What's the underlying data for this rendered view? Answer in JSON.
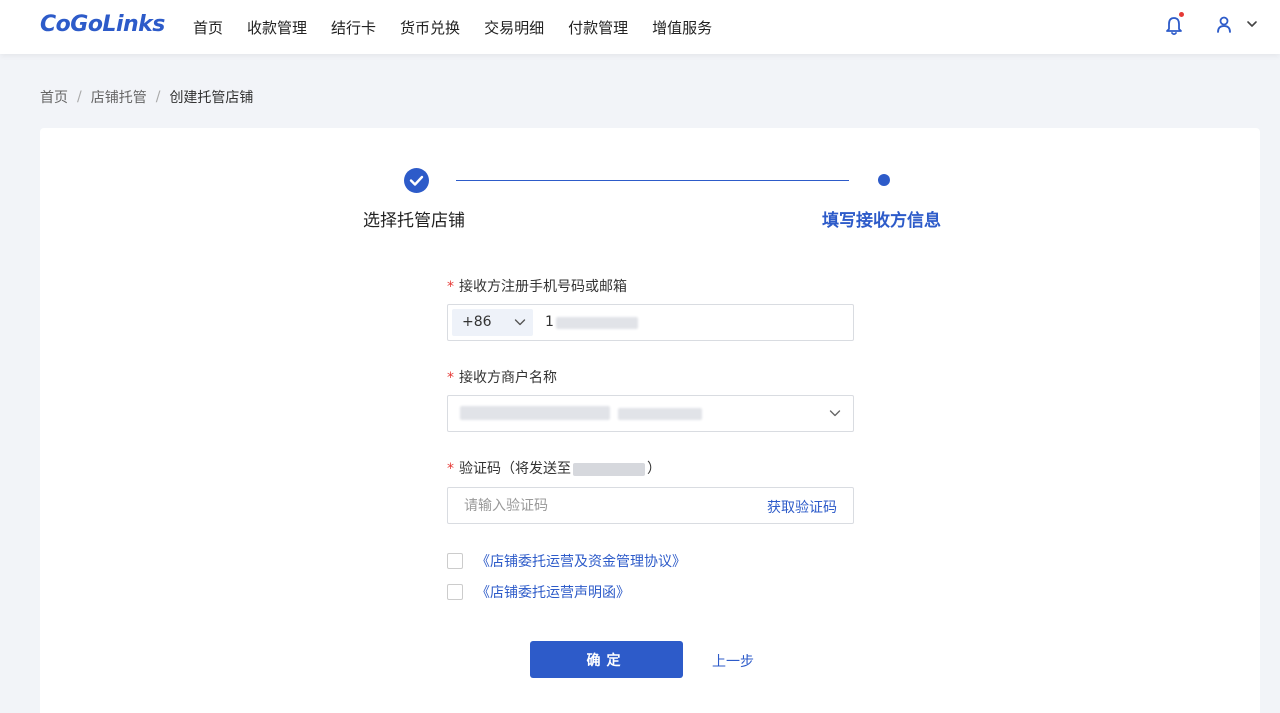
{
  "app": {
    "logo_text": "CoGoLinks",
    "brand_color": "#2d5bc9"
  },
  "nav": [
    {
      "label": "首页"
    },
    {
      "label": "收款管理"
    },
    {
      "label": "结行卡"
    },
    {
      "label": "货币兑换"
    },
    {
      "label": "交易明细"
    },
    {
      "label": "付款管理"
    },
    {
      "label": "增值服务"
    }
  ],
  "header_icons": {
    "bell": "bell-icon",
    "user": "user-icon",
    "menu": "chevron-down-icon"
  },
  "breadcrumb": {
    "home": "首页",
    "parent": "店铺托管",
    "current": "创建托管店铺"
  },
  "steps": {
    "step1": "选择托管店铺",
    "step2": "填写接收方信息"
  },
  "form": {
    "phone": {
      "label": "接收方注册手机号码或邮箱",
      "country_code": "+86",
      "value_visible": "1"
    },
    "merchant": {
      "label": "接收方商户名称"
    },
    "verify": {
      "label": "验证码（将发送至",
      "label_end": "）",
      "placeholder": "请输入验证码",
      "get_code": "获取验证码"
    }
  },
  "agreements": [
    {
      "text": "《店铺委托运营及资金管理协议》"
    },
    {
      "text": "《店铺委托运营声明函》"
    }
  ],
  "actions": {
    "confirm": "确定",
    "prev": "上一步"
  }
}
